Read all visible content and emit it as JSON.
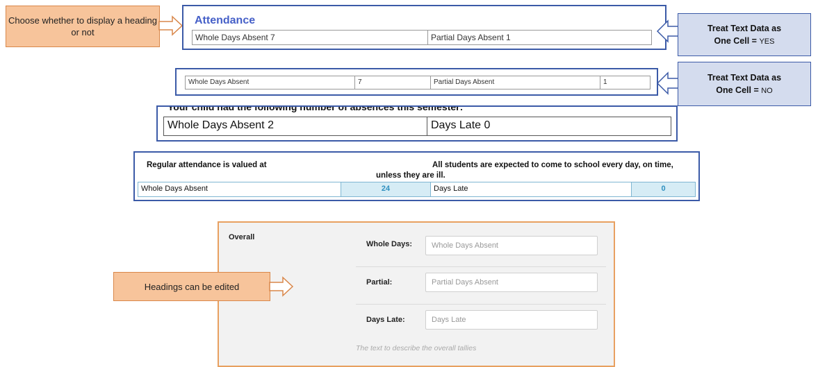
{
  "callouts": {
    "heading_choice": "Choose whether to display a heading or not",
    "headings_edited": "Headings can be edited",
    "yes": {
      "line1": "Treat Text Data as",
      "line2": "One Cell = ",
      "value": "YES"
    },
    "no": {
      "line1": "Treat Text Data as",
      "line2": "One Cell = ",
      "value": "NO"
    }
  },
  "panel_yes": {
    "title": "Attendance",
    "cells": [
      "Whole Days Absent 7",
      "Partial Days Absent 1"
    ]
  },
  "panel_no": {
    "cells": [
      "Whole Days Absent",
      "7",
      "Partial Days Absent",
      "1"
    ]
  },
  "panel_big": {
    "caption": "Your child had the following number of absences this semester:",
    "cells": [
      "Whole Days Absent 2",
      "Days Late 0"
    ]
  },
  "panel_regular": {
    "heading_left": "Regular attendance is valued at",
    "heading_right": "All students are expected to come to school every day, on time,",
    "heading_right2": "unless they are ill.",
    "cells": [
      "Whole Days Absent",
      "24",
      "Days Late",
      "0"
    ]
  },
  "form": {
    "section": "Overall",
    "rows": [
      {
        "label": "Whole Days:",
        "placeholder": "Whole Days Absent"
      },
      {
        "label": "Partial:",
        "placeholder": "Partial Days Absent"
      },
      {
        "label": "Days Late:",
        "placeholder": "Days Late"
      }
    ],
    "hint": "The text to describe the overall tallies"
  },
  "colors": {
    "accent_blue": "#3b5aa7",
    "callout_orange": "#f7c49b",
    "callout_blue": "#d4dcee",
    "form_border": "#e8a060"
  }
}
